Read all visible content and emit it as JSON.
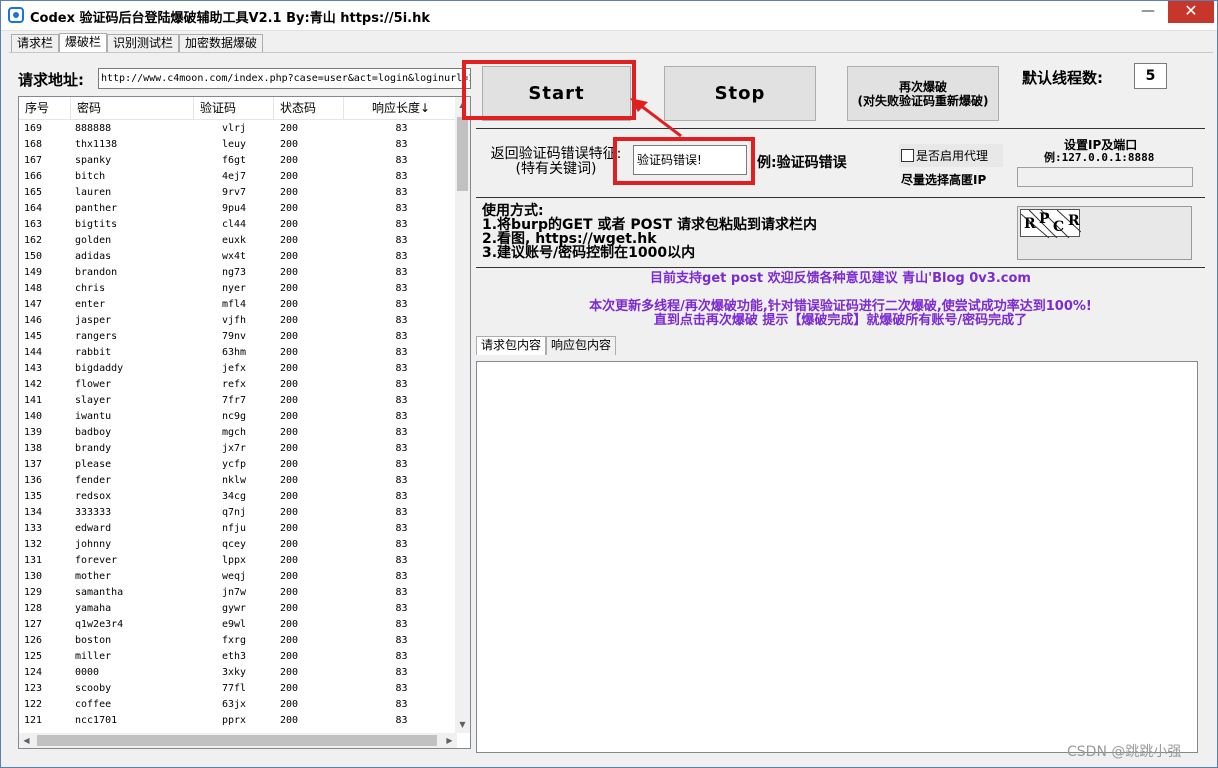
{
  "window": {
    "title": "Codex 验证码后台登陆爆破辅助工具V2.1  By:青山 https://5i.hk",
    "min_glyph": "—",
    "max_glyph": "☐",
    "close_glyph": "✕"
  },
  "tabs": [
    "请求栏",
    "爆破栏",
    "识别测试栏",
    "加密数据爆破"
  ],
  "active_tab": 1,
  "request": {
    "url_label": "请求地址:",
    "url_value": "http://www.c4moon.com/index.php?case=user&act=login&loginurl=1"
  },
  "table": {
    "columns": [
      "序号",
      "密码",
      "验证码",
      "状态码",
      "响应长度↓"
    ],
    "rows": [
      [
        "169",
        "888888",
        "vlrj",
        "200",
        "83"
      ],
      [
        "168",
        "thx1138",
        "leuy",
        "200",
        "83"
      ],
      [
        "167",
        "spanky",
        "f6gt",
        "200",
        "83"
      ],
      [
        "166",
        "bitch",
        "4ej7",
        "200",
        "83"
      ],
      [
        "165",
        "lauren",
        "9rv7",
        "200",
        "83"
      ],
      [
        "164",
        "panther",
        "9pu4",
        "200",
        "83"
      ],
      [
        "163",
        "bigtits",
        "cl44",
        "200",
        "83"
      ],
      [
        "162",
        "golden",
        "euxk",
        "200",
        "83"
      ],
      [
        "150",
        "adidas",
        "wx4t",
        "200",
        "83"
      ],
      [
        "149",
        "brandon",
        "ng73",
        "200",
        "83"
      ],
      [
        "148",
        "chris",
        "nyer",
        "200",
        "83"
      ],
      [
        "147",
        "enter",
        "mfl4",
        "200",
        "83"
      ],
      [
        "146",
        "jasper",
        "vjfh",
        "200",
        "83"
      ],
      [
        "145",
        "rangers",
        "79nv",
        "200",
        "83"
      ],
      [
        "144",
        "rabbit",
        "63hm",
        "200",
        "83"
      ],
      [
        "143",
        "bigdaddy",
        "jefx",
        "200",
        "83"
      ],
      [
        "142",
        "flower",
        "refx",
        "200",
        "83"
      ],
      [
        "141",
        "slayer",
        "7fr7",
        "200",
        "83"
      ],
      [
        "140",
        "iwantu",
        "nc9g",
        "200",
        "83"
      ],
      [
        "139",
        "badboy",
        "mgch",
        "200",
        "83"
      ],
      [
        "138",
        "brandy",
        "jx7r",
        "200",
        "83"
      ],
      [
        "137",
        "please",
        "ycfp",
        "200",
        "83"
      ],
      [
        "136",
        "fender",
        "nklw",
        "200",
        "83"
      ],
      [
        "135",
        "redsox",
        "34cg",
        "200",
        "83"
      ],
      [
        "134",
        "333333",
        "q7nj",
        "200",
        "83"
      ],
      [
        "133",
        "edward",
        "nfju",
        "200",
        "83"
      ],
      [
        "132",
        "johnny",
        "qcey",
        "200",
        "83"
      ],
      [
        "131",
        "forever",
        "lppx",
        "200",
        "83"
      ],
      [
        "130",
        "mother",
        "weqj",
        "200",
        "83"
      ],
      [
        "129",
        "samantha",
        "jn7w",
        "200",
        "83"
      ],
      [
        "128",
        "yamaha",
        "gywr",
        "200",
        "83"
      ],
      [
        "127",
        "q1w2e3r4",
        "e9wl",
        "200",
        "83"
      ],
      [
        "126",
        "boston",
        "fxrg",
        "200",
        "83"
      ],
      [
        "125",
        "miller",
        "eth3",
        "200",
        "83"
      ],
      [
        "124",
        "0000",
        "3xky",
        "200",
        "83"
      ],
      [
        "123",
        "scooby",
        "77fl",
        "200",
        "83"
      ],
      [
        "122",
        "coffee",
        "63jx",
        "200",
        "83"
      ],
      [
        "121",
        "ncc1701",
        "pprx",
        "200",
        "83"
      ]
    ]
  },
  "controls": {
    "start_label": "Start",
    "stop_label": "Stop",
    "retry_line1": "再次爆破",
    "retry_line2": "(对失败验证码重新爆破)",
    "thread_label": "默认线程数:",
    "thread_value": "5"
  },
  "error_feature": {
    "label_line1": "返回验证码错误特征:",
    "label_line2": "(特有关键词)",
    "value": "验证码错误!",
    "example": "例:验证码错误"
  },
  "proxy": {
    "checkbox_label": "是否启用代理",
    "tip": "尽量选择高匿IP",
    "ip_title": "设置IP及端口",
    "ip_example": "例:127.0.0.1:8888",
    "ip_value": ""
  },
  "usage": {
    "title": "使用方式:",
    "line1": "1.将burp的GET 或者 POST 请求包粘贴到请求栏内",
    "line2": "2.看图, https://wget.hk",
    "line3": "3.建议账号/密码控制在1000以内"
  },
  "captcha_text": "RPCR",
  "notices": {
    "line1": "目前支持get post 欢迎反馈各种意见建议 青山'Blog 0v3.com",
    "line2": "本次更新多线程/再次爆破功能,针对错误验证码进行二次爆破,使尝试成功率达到100%!",
    "line3": "直到点击再次爆破 提示【爆破完成】就爆破所有账号/密码完成了",
    "color": "#7b2bd0"
  },
  "subtabs": [
    "请求包内容",
    "响应包内容"
  ],
  "active_subtab": 0,
  "watermark": "CSDN @跳跳小强",
  "colors": {
    "annotation_red": "#e02020",
    "close_red": "#c7362b"
  }
}
